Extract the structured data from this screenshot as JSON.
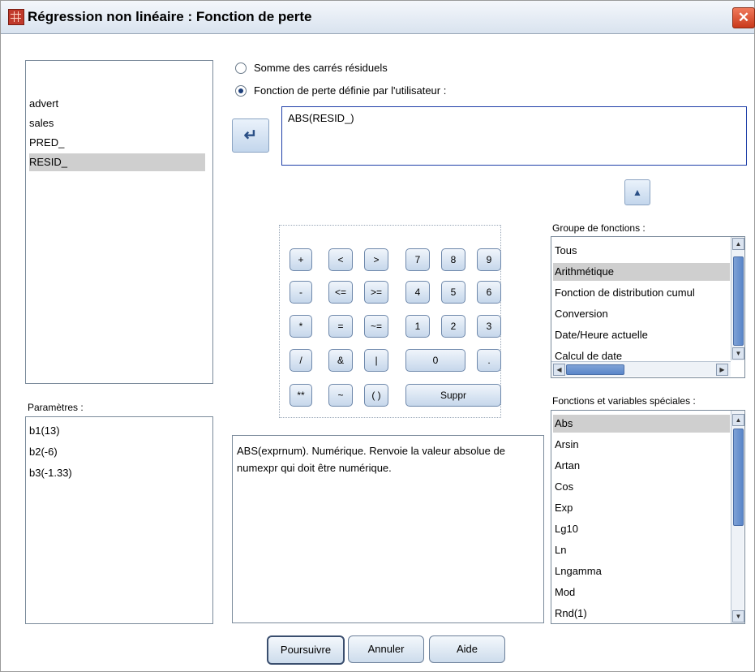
{
  "window": {
    "title": "Régression non linéaire : Fonction de perte",
    "close_glyph": "✕"
  },
  "variables": {
    "items": [
      "advert",
      "sales",
      "PRED_",
      "RESID_"
    ],
    "selected": "RESID_"
  },
  "parameters": {
    "label": "Paramètres :",
    "items": [
      "b1(13)",
      "b2(-6)",
      "b3(-1.33)"
    ]
  },
  "loss": {
    "option_sum": "Somme des carrés résiduels",
    "option_user": "Fonction de perte définie par l'utilisateur :",
    "selected": "user",
    "expression": "ABS(RESID_)"
  },
  "transfer_button_glyph": "↵",
  "up_button_glyph": "▲",
  "keypad": {
    "keys": [
      "+",
      "<",
      ">",
      "7",
      "8",
      "9",
      "-",
      "<=",
      ">=",
      "4",
      "5",
      "6",
      "*",
      "=",
      "~=",
      "1",
      "2",
      "3",
      "/",
      "&",
      "|",
      "0",
      ".",
      "**",
      "~",
      "( )",
      "Suppr"
    ]
  },
  "description": "ABS(exprnum). Numérique. Renvoie la valeur absolue de numexpr qui doit être numérique.",
  "function_group": {
    "label": "Groupe de fonctions :",
    "items": [
      "Tous",
      "Arithmétique",
      "Fonction de distribution cumul",
      "Conversion",
      "Date/Heure actuelle",
      "Calcul de date"
    ],
    "selected": "Arithmétique"
  },
  "special_functions": {
    "label": "Fonctions et variables spéciales :",
    "items": [
      "Abs",
      "Arsin",
      "Artan",
      "Cos",
      "Exp",
      "Lg10",
      "Ln",
      "Lngamma",
      "Mod",
      "Rnd(1)"
    ],
    "selected": "Abs"
  },
  "buttons": {
    "continue": "Poursuivre",
    "cancel": "Annuler",
    "help": "Aide"
  },
  "colors": {
    "titlebar": "#dbe5f1",
    "selection": "#cfcfcf",
    "accent_scroll": "#5a86c9"
  }
}
